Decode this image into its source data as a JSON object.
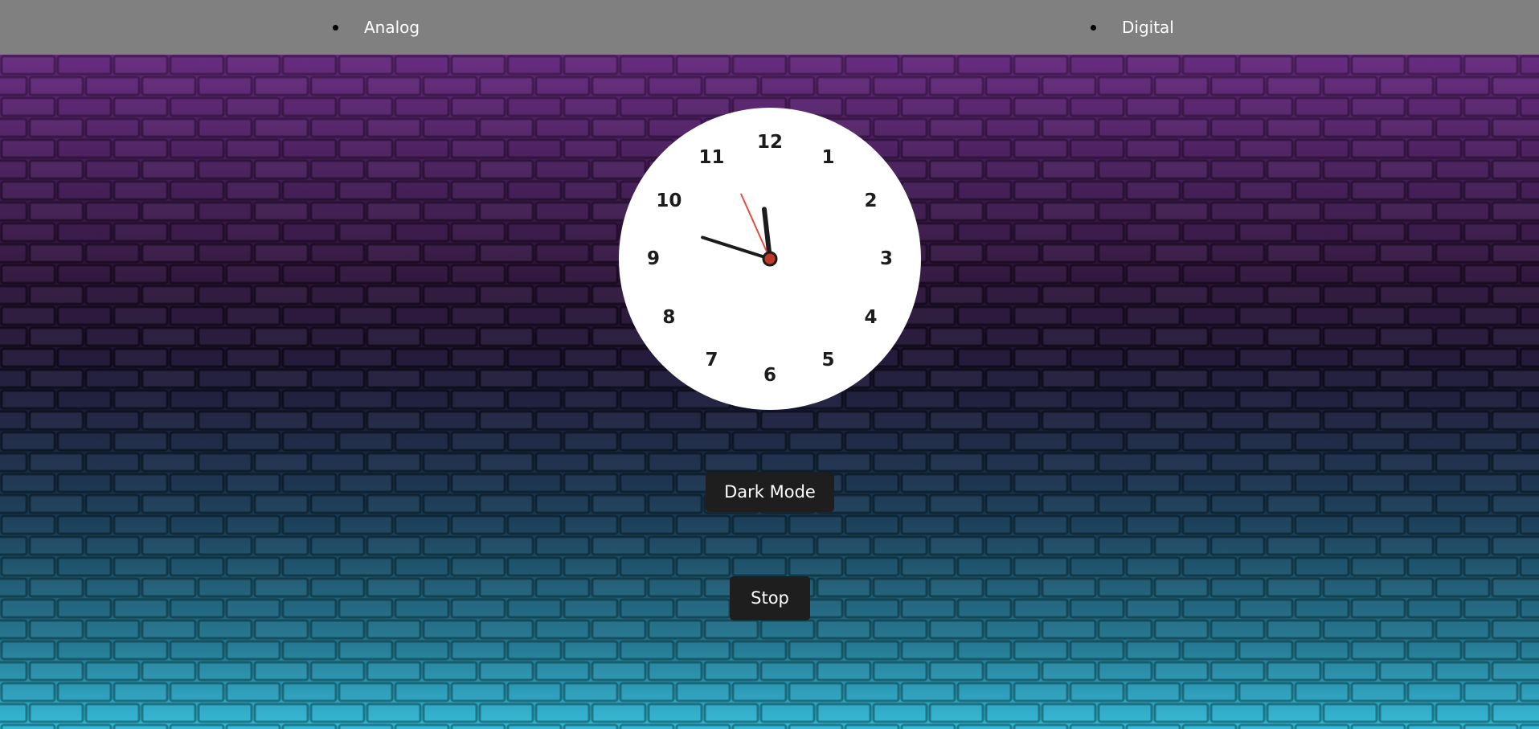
{
  "nav": {
    "items": [
      {
        "label": "Analog"
      },
      {
        "label": "Digital"
      }
    ]
  },
  "clock": {
    "numbers": [
      "12",
      "1",
      "2",
      "3",
      "4",
      "5",
      "6",
      "7",
      "8",
      "9",
      "10",
      "11"
    ],
    "time": {
      "hour": 11,
      "minute": 47,
      "second": 56
    },
    "colors": {
      "face": "#ffffff",
      "hands": "#1c1c1c",
      "second_hand": "#e74c3c",
      "center": "#c0392b"
    }
  },
  "buttons": {
    "dark_mode_label": "Dark Mode",
    "stop_label": "Stop"
  },
  "background": {
    "theme": "neon brick wall",
    "colors": {
      "top": "#4a1a5e",
      "bottom": "#2aa7c4"
    }
  }
}
